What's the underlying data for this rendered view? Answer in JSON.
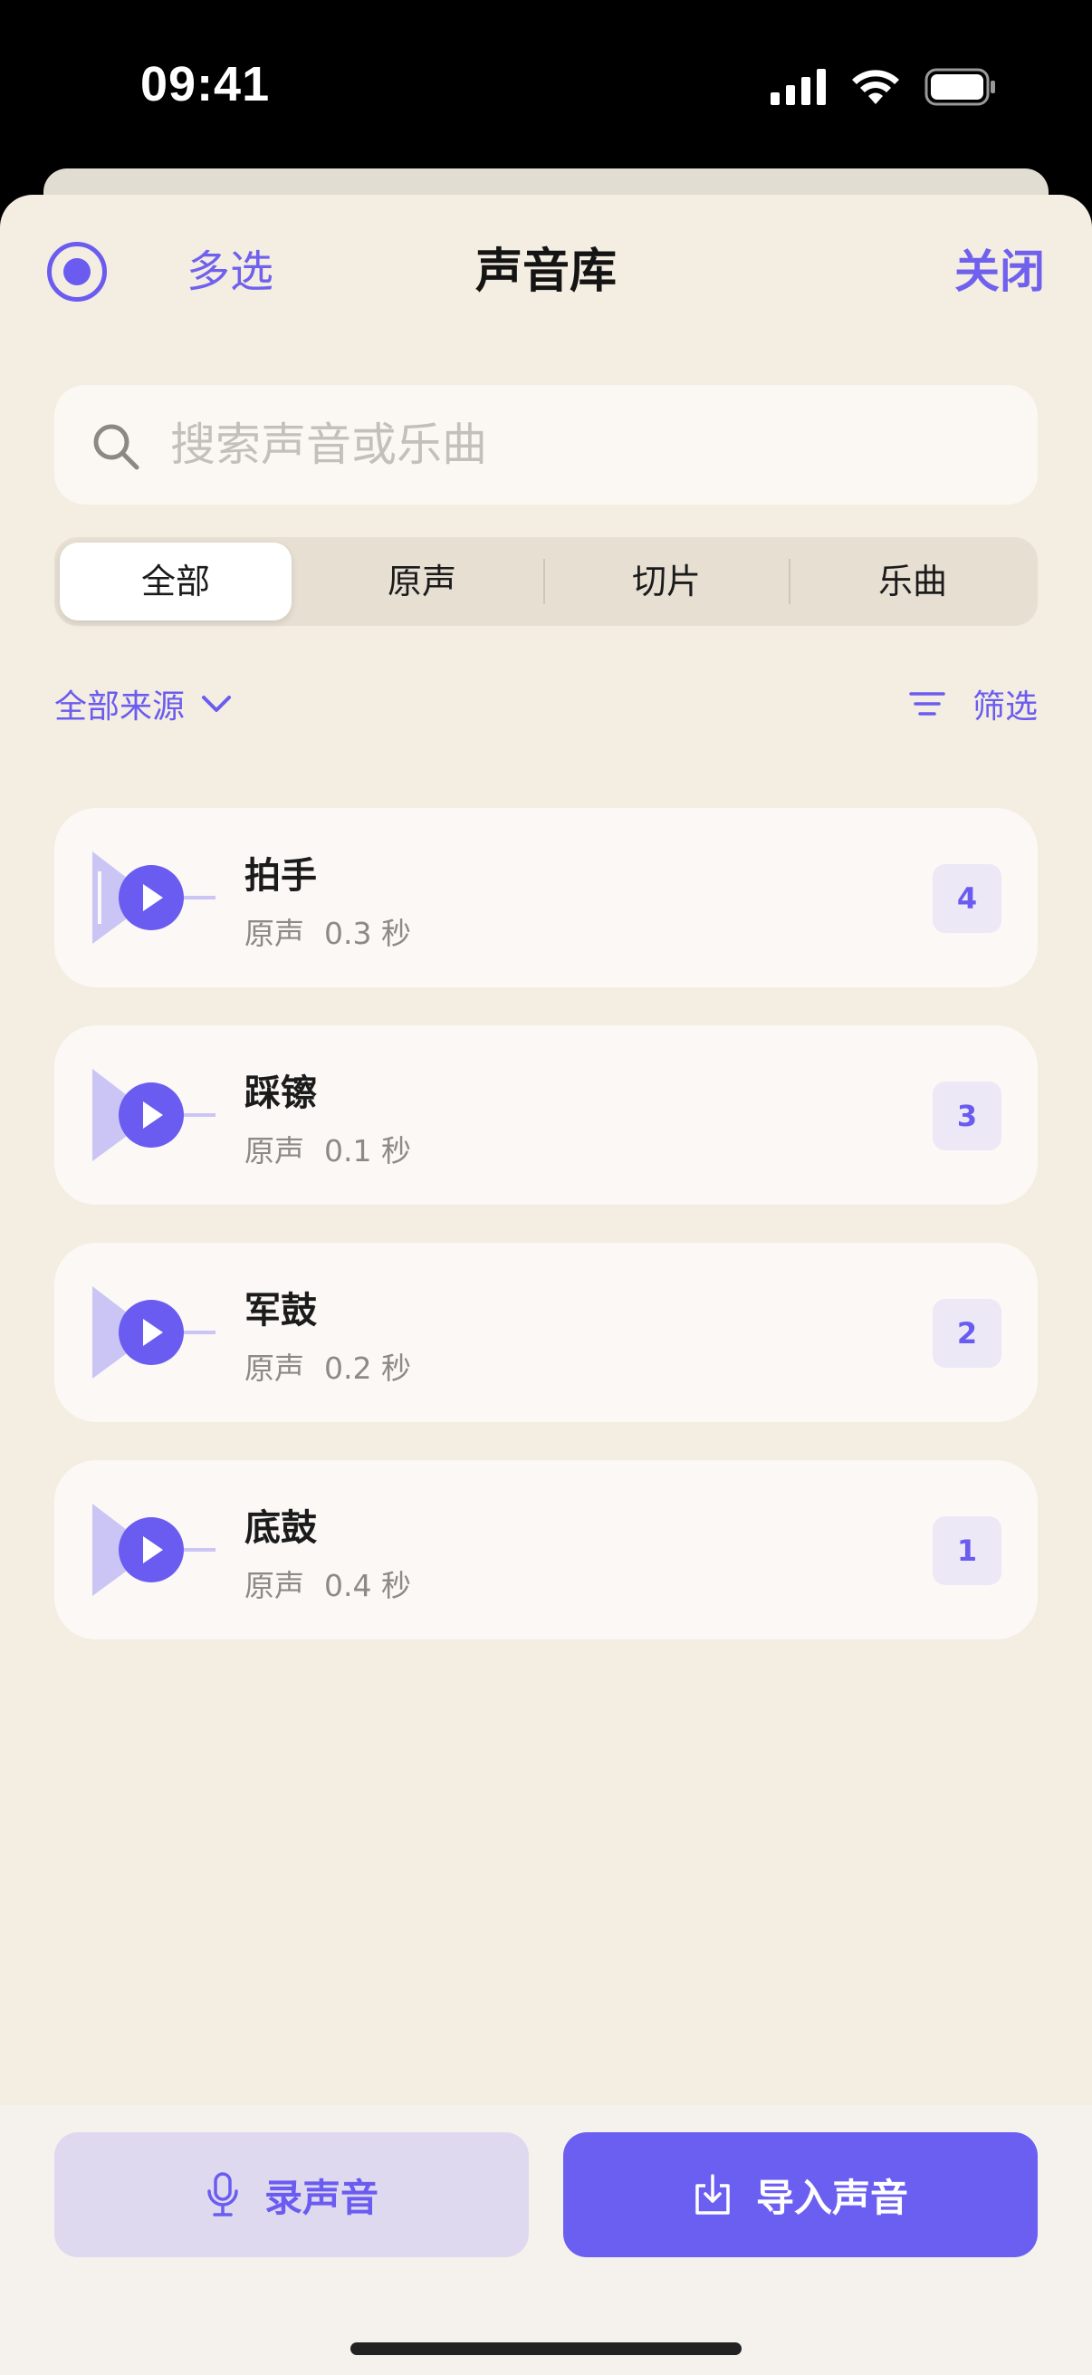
{
  "status": {
    "time": "09:41"
  },
  "header": {
    "multi_select": "多选",
    "title": "声音库",
    "close": "关闭"
  },
  "search": {
    "placeholder": "搜索声音或乐曲"
  },
  "segments": [
    {
      "label": "全部",
      "active": true
    },
    {
      "label": "原声",
      "active": false
    },
    {
      "label": "切片",
      "active": false
    },
    {
      "label": "乐曲",
      "active": false
    }
  ],
  "filters": {
    "source": "全部来源",
    "filter": "筛选"
  },
  "sounds": [
    {
      "name": "拍手",
      "type": "原声",
      "duration": "0.3 秒",
      "count": "4"
    },
    {
      "name": "踩镲",
      "type": "原声",
      "duration": "0.1 秒",
      "count": "3"
    },
    {
      "name": "军鼓",
      "type": "原声",
      "duration": "0.2 秒",
      "count": "2"
    },
    {
      "name": "底鼓",
      "type": "原声",
      "duration": "0.4 秒",
      "count": "1"
    }
  ],
  "actions": {
    "record": "录声音",
    "import": "导入声音"
  },
  "colors": {
    "accent": "#6a5cf0",
    "background": "#f4ede1",
    "card": "#fbf8f5"
  }
}
